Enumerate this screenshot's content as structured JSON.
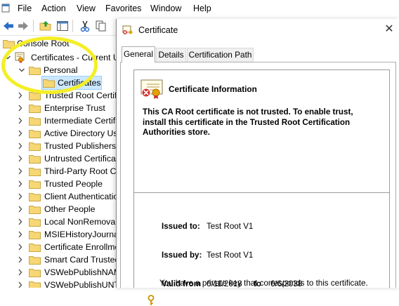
{
  "menubar": {
    "items": [
      "File",
      "Action",
      "View",
      "Favorites",
      "Window",
      "Help"
    ]
  },
  "toolbar": {
    "buttons": [
      "back-arrow-icon",
      "forward-arrow-icon",
      "up-folder-icon",
      "show-hide-tree-icon",
      "cut-icon",
      "copy-icon"
    ]
  },
  "tree": {
    "root": "Console Root",
    "snapin": "Certificates - Current U",
    "expanded": "Personal",
    "selected": "Certificates",
    "stores": [
      "Trusted Root Certifi",
      "Enterprise Trust",
      "Intermediate Certifi",
      "Active Directory Use",
      "Trusted Publishers",
      "Untrusted Certificat",
      "Third-Party Root Ce",
      "Trusted People",
      "Client Authenticatio",
      "Other People",
      "Local NonRemovab",
      "MSIEHistoryJournal",
      "Certificate Enrollme",
      "Smart Card Trusted",
      "VSWebPublishNAM",
      "VSWebPublishUNTI"
    ]
  },
  "dialog": {
    "title": "Certificate",
    "close": "✕",
    "tabs": [
      "General",
      "Details",
      "Certification Path"
    ],
    "active_tab": "General",
    "info_title": "Certificate Information",
    "trust_message": "This CA Root certificate is not trusted. To enable trust, install this certificate in the Trusted Root Certification Authorities store.",
    "issued_to_label": "Issued to:",
    "issued_to": "Test Root V1",
    "issued_by_label": "Issued by:",
    "issued_by": "Test Root V1",
    "valid_from_label": "Valid from",
    "valid_from": "6/11/2018",
    "valid_to_label": "to",
    "valid_to": "6/6/2038",
    "key_note": "You have a private key that corresponds to this certificate."
  },
  "colors": {
    "selection": "#cce8ff",
    "annotation_circle": "#f4ee26",
    "folder": "#f7d774"
  }
}
